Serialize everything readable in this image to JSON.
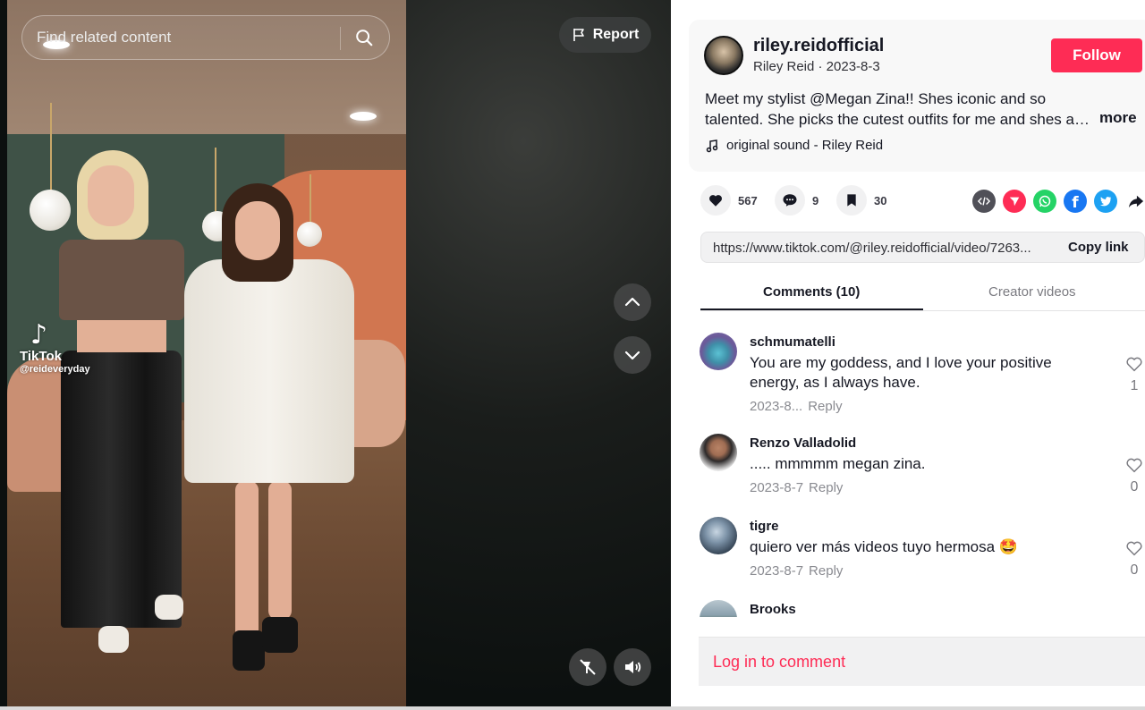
{
  "search": {
    "placeholder": "Find related content"
  },
  "report": {
    "label": "Report"
  },
  "video": {
    "watermark_brand": "TikTok",
    "watermark_user": "@reideveryday"
  },
  "post": {
    "author_handle": "riley.reidofficial",
    "author_meta": "Riley Reid · 2023-8-3",
    "follow_label": "Follow",
    "description": "Meet my stylist @Megan Zina!! Shes iconic and so talented. She picks the cutest outfits for me and shes an actual...",
    "more_label": "more",
    "music": "original sound - Riley Reid"
  },
  "actions": {
    "likes": "567",
    "comments": "9",
    "saves": "30"
  },
  "share_icons": [
    "embed-icon",
    "send-icon",
    "whatsapp-icon",
    "facebook-icon",
    "twitter-icon",
    "share-arrow-icon"
  ],
  "link": {
    "url": "https://www.tiktok.com/@riley.reidofficial/video/7263...",
    "copy_label": "Copy link"
  },
  "tabs": {
    "comments": "Comments (10)",
    "creator": "Creator videos"
  },
  "comments": [
    {
      "user": "schmumatelli",
      "text": "You are my goddess, and I love your positive energy, as I always have.",
      "date": "2023-8...",
      "reply": "Reply",
      "likes": "1"
    },
    {
      "user": "Renzo Valladolid",
      "text": "..... mmmmm megan zina.",
      "date": "2023-8-7",
      "reply": "Reply",
      "likes": "0"
    },
    {
      "user": "tigre",
      "text": "quiero ver más videos tuyo hermosa 🤩",
      "date": "2023-8-7",
      "reply": "Reply",
      "likes": "0"
    },
    {
      "user": "Brooks"
    }
  ],
  "login": {
    "label": "Log in to comment"
  },
  "colors": {
    "accent": "#fe2c55",
    "text": "#161823",
    "muted": "#8a8b91"
  }
}
